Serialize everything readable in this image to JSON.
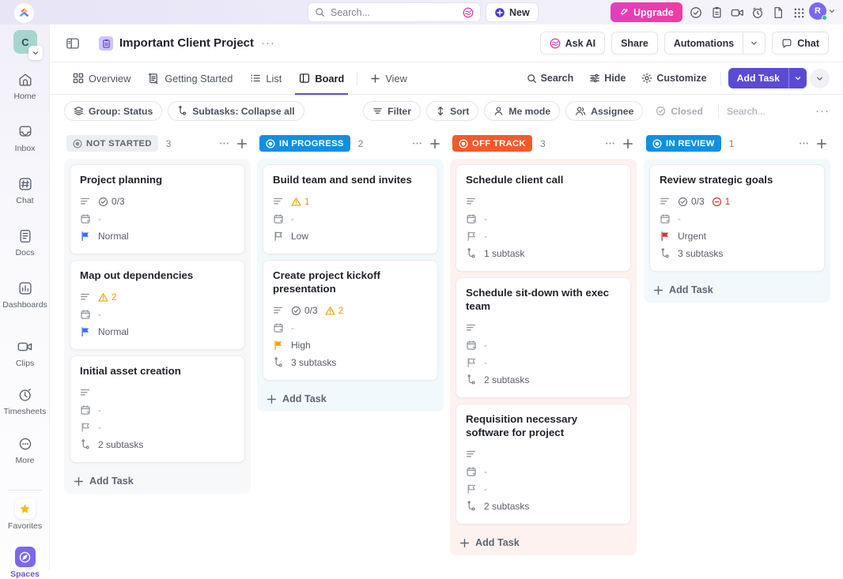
{
  "topbar": {
    "logo": "clickup-logo",
    "search_placeholder": "Search...",
    "ai_icon": "ask-ai-icon",
    "new_label": "New",
    "upgrade_label": "Upgrade",
    "icons": [
      "check-circle-icon",
      "clipboard-icon",
      "video-camera-icon",
      "alarm-clock-icon",
      "document-icon",
      "apps-grid-icon"
    ],
    "avatar_initial": "R"
  },
  "sidebar": {
    "workspace_initial": "C",
    "items": [
      {
        "label": "Home",
        "icon": "home-icon"
      },
      {
        "label": "Inbox",
        "icon": "inbox-icon"
      },
      {
        "label": "Chat",
        "icon": "chat-hash-icon"
      },
      {
        "label": "Docs",
        "icon": "docs-icon"
      },
      {
        "label": "Dashboards",
        "icon": "dashboards-icon"
      },
      {
        "label": "Clips",
        "icon": "clips-icon"
      },
      {
        "label": "Timesheets",
        "icon": "timesheets-icon"
      },
      {
        "label": "More",
        "icon": "more-ellipsis-icon"
      }
    ],
    "favorites_label": "Favorites",
    "spaces_label": "Spaces"
  },
  "project_header": {
    "title": "Important Client Project",
    "dots": "···",
    "ask_ai": "Ask AI",
    "share": "Share",
    "automations": "Automations",
    "chat": "Chat"
  },
  "tabs": {
    "items": [
      {
        "label": "Overview",
        "icon": "overview-grid-icon",
        "active": false
      },
      {
        "label": "Getting Started",
        "icon": "getting-started-icon",
        "active": false
      },
      {
        "label": "List",
        "icon": "list-icon",
        "active": false
      },
      {
        "label": "Board",
        "icon": "board-icon",
        "active": true
      }
    ],
    "add_view": "View",
    "search": "Search",
    "hide": "Hide",
    "customize": "Customize",
    "add_task": "Add Task"
  },
  "filter_row": {
    "group": "Group: Status",
    "subtasks": "Subtasks: Collapse all",
    "filter": "Filter",
    "sort": "Sort",
    "me_mode": "Me mode",
    "assignee": "Assignee",
    "closed": "Closed",
    "search_placeholder": "Search...",
    "overflow": "···"
  },
  "board": {
    "add_task_label": "Add Task",
    "columns": [
      {
        "status": "NOT STARTED",
        "count": "3",
        "chip_bg": "#eceef1",
        "chip_fg": "#62676f",
        "dot": "#8b9098",
        "body_bg": "#f7f8f9",
        "cards": [
          {
            "title": "Project planning",
            "checklist": "0/3",
            "warnings": null,
            "errors": null,
            "date": "-",
            "priority": "Normal",
            "priority_color": "#3b6ef5",
            "subtasks": null
          },
          {
            "title": "Map out dependencies",
            "checklist": null,
            "warnings": "2",
            "errors": null,
            "date": "-",
            "priority": "Normal",
            "priority_color": "#3b6ef5",
            "subtasks": null
          },
          {
            "title": "Initial asset creation",
            "checklist": null,
            "warnings": null,
            "errors": null,
            "date": "-",
            "priority": "-",
            "priority_color": "#9ba0a9",
            "subtasks": "2 subtasks"
          }
        ]
      },
      {
        "status": "IN PROGRESS",
        "count": "2",
        "chip_bg": "#1090e0",
        "chip_fg": "#ffffff",
        "dot": "#ffffff",
        "body_bg": "#f2f9fd",
        "cards": [
          {
            "title": "Build team and send invites",
            "checklist": null,
            "warnings": "1",
            "errors": null,
            "date": "-",
            "priority": "Low",
            "priority_color": "#868c96",
            "subtasks": null
          },
          {
            "title": "Create project kickoff presentation",
            "checklist": "0/3",
            "warnings": "2",
            "errors": null,
            "date": "-",
            "priority": "High",
            "priority_color": "#f0a30a",
            "subtasks": "3 subtasks"
          }
        ]
      },
      {
        "status": "OFF TRACK",
        "count": "3",
        "chip_bg": "#f8592a",
        "chip_fg": "#ffffff",
        "dot": "#ffffff",
        "body_bg": "#fdf2ef",
        "cards": [
          {
            "title": "Schedule client call",
            "checklist": null,
            "warnings": null,
            "errors": null,
            "date": "-",
            "priority": "-",
            "priority_color": "#9ba0a9",
            "subtasks": "1 subtask"
          },
          {
            "title": "Schedule sit-down with exec team",
            "checklist": null,
            "warnings": null,
            "errors": null,
            "date": "-",
            "priority": "-",
            "priority_color": "#9ba0a9",
            "subtasks": "2 subtasks"
          },
          {
            "title": "Requisition necessary software for project",
            "checklist": null,
            "warnings": null,
            "errors": null,
            "date": "-",
            "priority": "-",
            "priority_color": "#9ba0a9",
            "subtasks": "2 subtasks"
          }
        ]
      },
      {
        "status": "IN REVIEW",
        "count": "1",
        "chip_bg": "#1090e0",
        "chip_fg": "#ffffff",
        "dot": "#ffffff",
        "body_bg": "#f2f9fd",
        "cards": [
          {
            "title": "Review strategic goals",
            "checklist": "0/3",
            "warnings": null,
            "errors": "1",
            "date": "-",
            "priority": "Urgent",
            "priority_color": "#cf3a3a",
            "subtasks": "3 subtasks"
          }
        ]
      }
    ]
  }
}
